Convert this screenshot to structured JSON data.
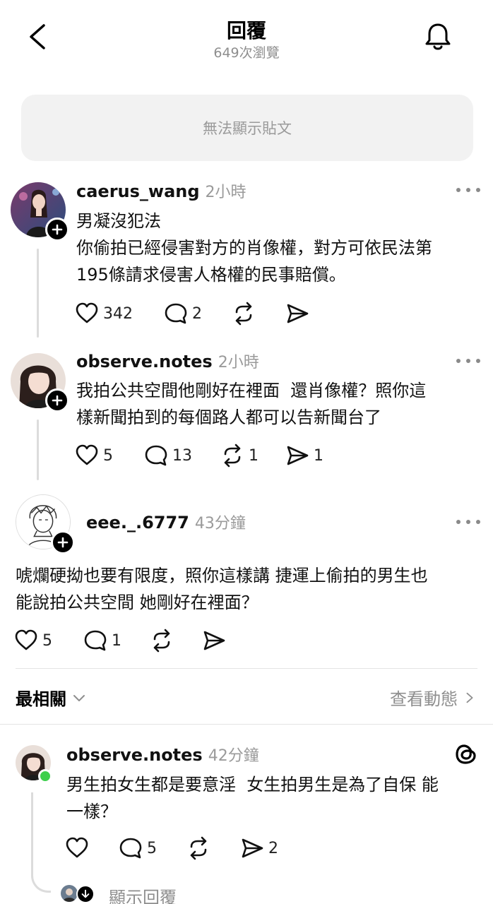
{
  "header": {
    "title": "回覆",
    "views": "649次瀏覽"
  },
  "notice": {
    "text": "無法顯示貼文"
  },
  "comments": [
    {
      "username": "caerus_wang",
      "time": "2小時",
      "lines": [
        "男凝沒犯法",
        "你偷拍已經侵害對方的肖像權，對方可依民法第",
        "195條請求侵害人格權的民事賠償。"
      ],
      "likes": "342",
      "replies": "2",
      "reposts": "",
      "shares": ""
    },
    {
      "username": "observe.notes",
      "time": "2小時",
      "lines": [
        "我拍公共空間他剛好在裡面  還肖像權？照你這",
        "樣新聞拍到的每個路人都可以告新聞台了"
      ],
      "likes": "5",
      "replies": "13",
      "reposts": "1",
      "shares": "1"
    },
    {
      "username": "eee._.6777",
      "time": "43分鐘",
      "lines": [
        "唬爛硬拗也要有限度，照你這樣講 捷運上偷拍的男生也",
        "能說拍公共空間 她剛好在裡面？"
      ],
      "likes": "5",
      "replies": "1",
      "reposts": "",
      "shares": ""
    }
  ],
  "sort": {
    "label": "最相關",
    "activity": "查看動態"
  },
  "reply": {
    "username": "observe.notes",
    "time": "42分鐘",
    "lines": [
      "男生拍女生都是要意淫  女生拍男生是為了自保 能",
      "一樣？"
    ],
    "likes": "",
    "replies": "5",
    "reposts": "",
    "shares": "2",
    "show_replies": "顯示回覆"
  },
  "colors": {
    "muted": "#8e8e8e",
    "online": "#3ecf4c",
    "panel": "#f2f2f2"
  }
}
